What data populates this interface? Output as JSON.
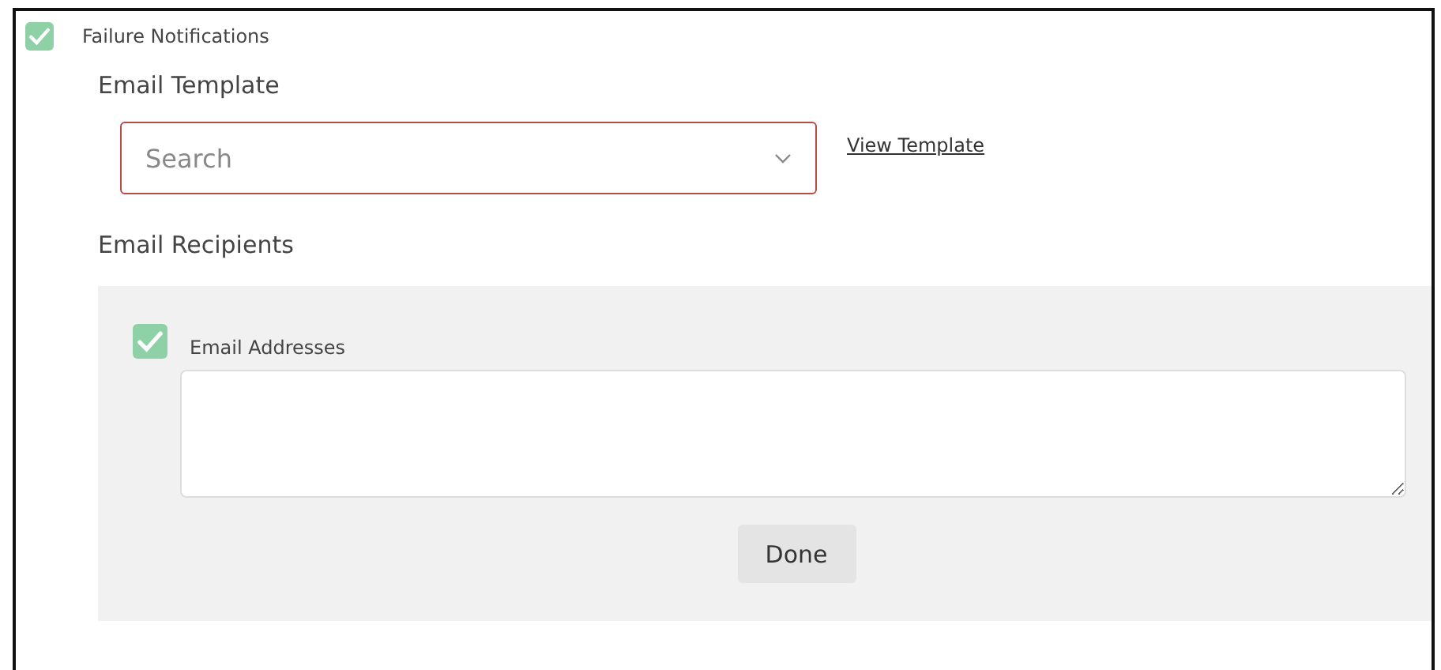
{
  "failure_notifications": {
    "label": "Failure Notifications",
    "checked": true
  },
  "email_template": {
    "heading": "Email Template",
    "select": {
      "placeholder": "Search",
      "invalid": true
    },
    "link": "View Template"
  },
  "email_recipients": {
    "heading": "Email Recipients",
    "addresses": {
      "label": "Email Addresses",
      "checked": true
    },
    "button": "Done"
  }
}
